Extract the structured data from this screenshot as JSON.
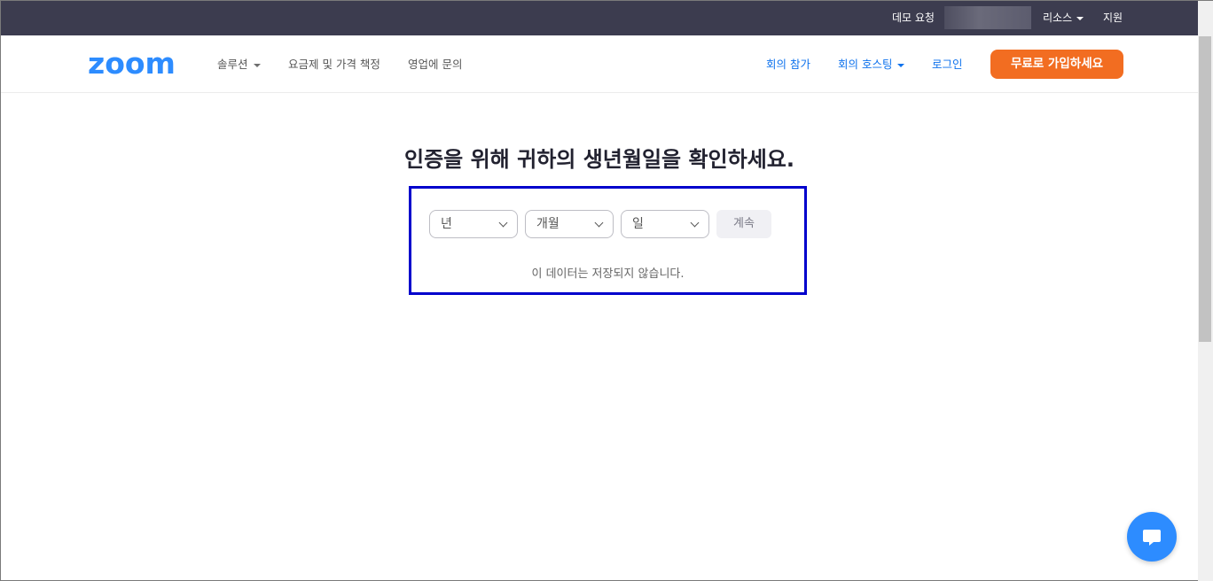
{
  "topbar": {
    "demo_request": "데모 요청",
    "resources": "리소스",
    "support": "지원"
  },
  "nav": {
    "logo": "zoom",
    "solutions": "솔루션",
    "pricing": "요금제 및 가격 책정",
    "contact_sales": "영업에 문의",
    "join_meeting": "회의 참가",
    "host_meeting": "회의 호스팅",
    "login": "로그인",
    "signup": "무료로 가입하세요"
  },
  "main": {
    "heading": "인증을 위해 귀하의 생년월일을 확인하세요.",
    "year_placeholder": "년",
    "month_placeholder": "개월",
    "day_placeholder": "일",
    "continue_label": "계속",
    "note": "이 데이터는 저장되지 않습니다."
  },
  "icons": {
    "chat": "chat-bubble-icon",
    "dropdown": "chevron-down-icon",
    "caret": "caret-down-icon"
  },
  "colors": {
    "brand_blue": "#2d8cff",
    "signup_orange": "#f26d21",
    "topbar_bg": "#3c3c4f",
    "highlight_frame": "#0000cc"
  }
}
